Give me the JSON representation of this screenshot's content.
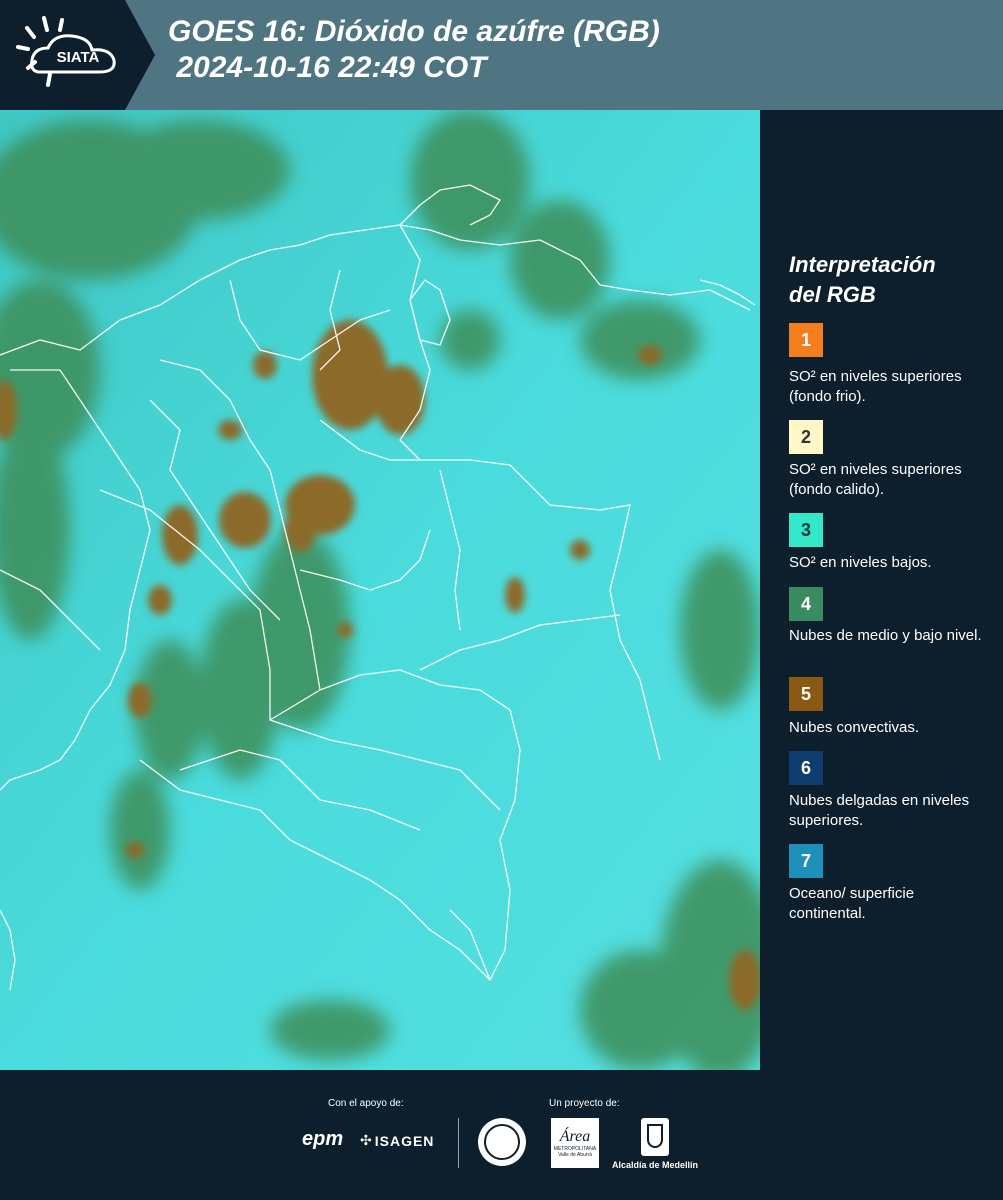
{
  "header": {
    "title_line1": "GOES 16: Dióxido de azúfre (RGB)",
    "title_line2": " 2024-10-16 22:49 COT",
    "logo_text": "SIATA"
  },
  "legend": {
    "title_line1": "Interpretación",
    "title_line2": "del RGB",
    "items": [
      {
        "number": "1",
        "color": "#f47e1c",
        "number_color": "#ffffff",
        "label": "SO² en niveles superiores (fondo frio)."
      },
      {
        "number": "2",
        "color": "#fff7c8",
        "number_color": "#333333",
        "label": "SO² en niveles superiores (fondo calido)."
      },
      {
        "number": "3",
        "color": "#33e7c9",
        "number_color": "#0d3b38",
        "label": "SO² en niveles bajos."
      },
      {
        "number": "4",
        "color": "#3a8a62",
        "number_color": "#ffffff",
        "label": "Nubes de medio y bajo nivel."
      },
      {
        "number": "5",
        "color": "#8a5a15",
        "number_color": "#ffffff",
        "label": "Nubes convectivas."
      },
      {
        "number": "6",
        "color": "#0f3d6e",
        "number_color": "#ffffff",
        "label": "Nubes delgadas en niveles superiores."
      },
      {
        "number": "7",
        "color": "#1e8fb8",
        "number_color": "#ffffff",
        "label": "Oceano/ superficie continental."
      }
    ]
  },
  "footer": {
    "support_caption": "Con el apoyo de:",
    "project_caption": "Un proyecto de:",
    "epm_text": "epm",
    "isagen_text": "ISAGEN",
    "area_text": "Área",
    "area_sub": "METROPOLITANA",
    "area_sub2": "Valle de Aburrá",
    "alcaldia_text": "Alcaldía de Medellín"
  },
  "map": {
    "colors": {
      "land_bg": "#45d9da",
      "cloud_green": "#3f8f55",
      "convective": "#8b6a2a",
      "border": "#ffffff"
    }
  }
}
